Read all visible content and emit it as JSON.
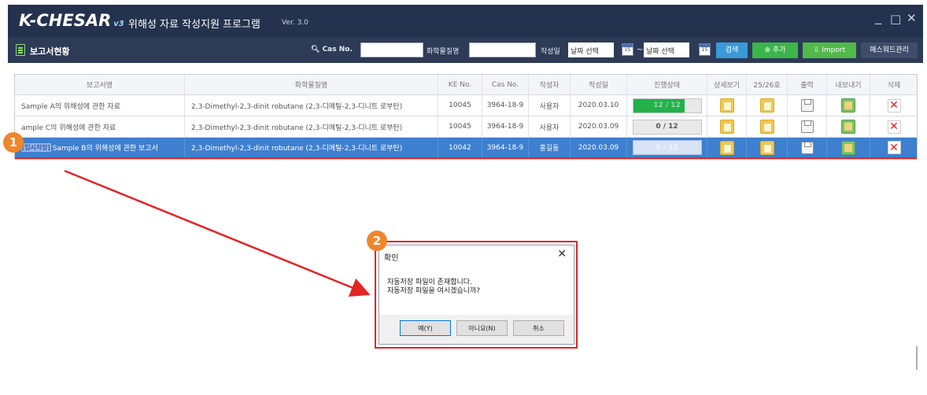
{
  "window": {
    "logo": "K-CHESAR",
    "logo_version": "v3",
    "title": "위해성 자료 작성지원 프로그램",
    "version": "Ver. 3.0",
    "minimize": "_",
    "maximize": "□",
    "close": "✕"
  },
  "toolbar": {
    "title": "보고서현황",
    "cas_label": "Cas No.",
    "cas_value": "",
    "chem_label": "화학물질명",
    "chem_value": "",
    "date_label": "작성일",
    "date_from": "날짜 선택",
    "date_sep": "~",
    "date_to": "날짜 선택",
    "cal_day": "15",
    "search_btn": "검색",
    "add_btn": "⊕ 추가",
    "import_btn": "Import",
    "password_btn": "패스워드관리"
  },
  "table": {
    "headers": [
      "보고서명",
      "화학물질명",
      "KE No.",
      "Cas No.",
      "작성자",
      "작성일",
      "진행상태",
      "상세보기",
      "25/26호",
      "출력",
      "내보내기",
      "삭제"
    ],
    "rows": [
      {
        "tag": "",
        "name": "Sample  A의 위해성에 관한 자료",
        "chemical": "2,3-Dimethyl-2,3-dinit robutane (2,3-디메틸-2,3-디니트 로부탄)",
        "ke_no": "10045",
        "cas_no": "3964-18-9",
        "author": "사용자",
        "date": "2020.03.10",
        "progress_text": "12 / 12",
        "progress_fraction": 0.76
      },
      {
        "tag": "",
        "name": "ample C의 위해성에 관한 자료",
        "chemical": "2,3-Dimethyl-2,3-dinit robutane (2,3-디메틸-2,3-디니트 로부탄)",
        "ke_no": "10045",
        "cas_no": "3964-18-9",
        "author": "사용자",
        "date": "2020.03.09",
        "progress_text": "0 / 12",
        "progress_fraction": 0
      },
      {
        "tag": "[임시저장]",
        "name": "Sample B의 위해성에 관한 보고서",
        "chemical": "2,3-Dimethyl-2,3-dinit robutane (2,3-디메틸-2,3-디니트 로부탄)",
        "ke_no": "10042",
        "cas_no": "3964-18-9",
        "author": "홍길동",
        "date": "2020.03.09",
        "progress_text": "0 / 12",
        "progress_fraction": 0
      }
    ]
  },
  "annotations": {
    "step1": "1",
    "step2": "2"
  },
  "dialog": {
    "title": "확인",
    "close": "✕",
    "message_line1": "자동저장 파일이 존재합니다.",
    "message_line2": "자동저장 파일을 여시겠습니까?",
    "yes": "예(Y)",
    "no": "아니요(N)",
    "cancel": "취소"
  },
  "colors": {
    "titlebar": "#24324d",
    "toolbar": "#2d3b57",
    "selected_row": "#3e7fcf",
    "progress_fill": "#21b24a",
    "highlight": "#e42525",
    "badge": "#f0862b"
  }
}
